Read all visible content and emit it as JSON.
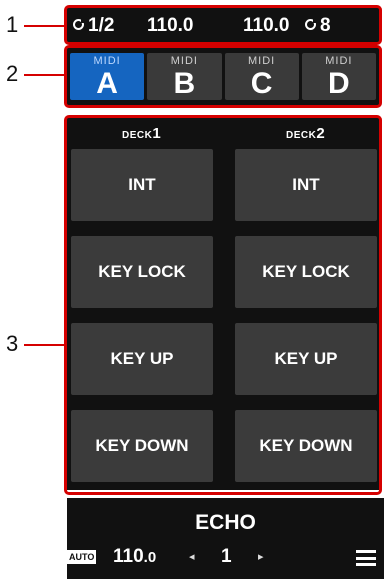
{
  "callouts": [
    "1",
    "2",
    "3"
  ],
  "status_bar": {
    "left_sync_icon": "sync-icon",
    "left_beat": "1/2",
    "left_bpm": "110.0",
    "right_bpm": "110.0",
    "right_sync_icon": "sync-icon",
    "right_beat": "8"
  },
  "midi_tabs": [
    {
      "sub": "MIDI",
      "letter": "A",
      "active": true
    },
    {
      "sub": "MIDI",
      "letter": "B",
      "active": false
    },
    {
      "sub": "MIDI",
      "letter": "C",
      "active": false
    },
    {
      "sub": "MIDI",
      "letter": "D",
      "active": false
    }
  ],
  "decks": [
    {
      "label": "DECK",
      "num": "1",
      "pads": [
        "INT",
        "KEY LOCK",
        "KEY UP",
        "KEY DOWN"
      ]
    },
    {
      "label": "DECK",
      "num": "2",
      "pads": [
        "INT",
        "KEY LOCK",
        "KEY UP",
        "KEY DOWN"
      ]
    }
  ],
  "bottom_bar": {
    "effect_name": "ECHO",
    "auto_badge": "AUTO",
    "bpm_int": "110",
    "bpm_dec": ".0",
    "prev_arrow": "◂",
    "beat": "1",
    "next_arrow": "▸",
    "menu_icon": "hamburger-menu-icon"
  },
  "colors": {
    "callout_red": "#d50000",
    "active_tab": "#1565c0",
    "pad": "#3b3b3b",
    "panel_bg": "#111111"
  }
}
